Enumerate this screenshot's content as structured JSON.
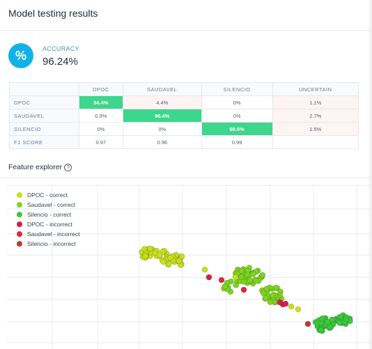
{
  "header": {
    "title": "Model testing results"
  },
  "accuracy": {
    "icon": "%",
    "label": "ACCURACY",
    "value": "96.24%"
  },
  "matrix": {
    "columns": [
      "",
      "DPOC",
      "SAUDAVEL",
      "SILENCIO",
      "UNCERTAIN"
    ],
    "rows": [
      {
        "label": "DPOC",
        "cells": [
          "94.4%",
          "4.4%",
          "0%",
          "1.1%"
        ]
      },
      {
        "label": "SAUDAVEL",
        "cells": [
          "0.9%",
          "96.4%",
          "0%",
          "2.7%"
        ]
      },
      {
        "label": "SILENCIO",
        "cells": [
          "0%",
          "0%",
          "98.5%",
          "1.5%"
        ]
      },
      {
        "label": "F1 SCORE",
        "cells": [
          "0.97",
          "0.96",
          "0.99",
          ""
        ]
      }
    ]
  },
  "feature_explorer": {
    "title": "Feature explorer",
    "help_icon": "?",
    "legend": [
      {
        "label": "DPOC - correct",
        "color": "#c6e01e"
      },
      {
        "label": "Saudavel - correct",
        "color": "#7ed321"
      },
      {
        "label": "Silencio - correct",
        "color": "#3cc83c"
      },
      {
        "label": "DPOC - incorrect",
        "color": "#d81b4f"
      },
      {
        "label": "Saudavel - incorrect",
        "color": "#e0283a"
      },
      {
        "label": "Silencio - incorrect",
        "color": "#c0392b"
      }
    ]
  },
  "colors": {
    "accent": "#11b2e8",
    "good": "#3dd68c"
  }
}
